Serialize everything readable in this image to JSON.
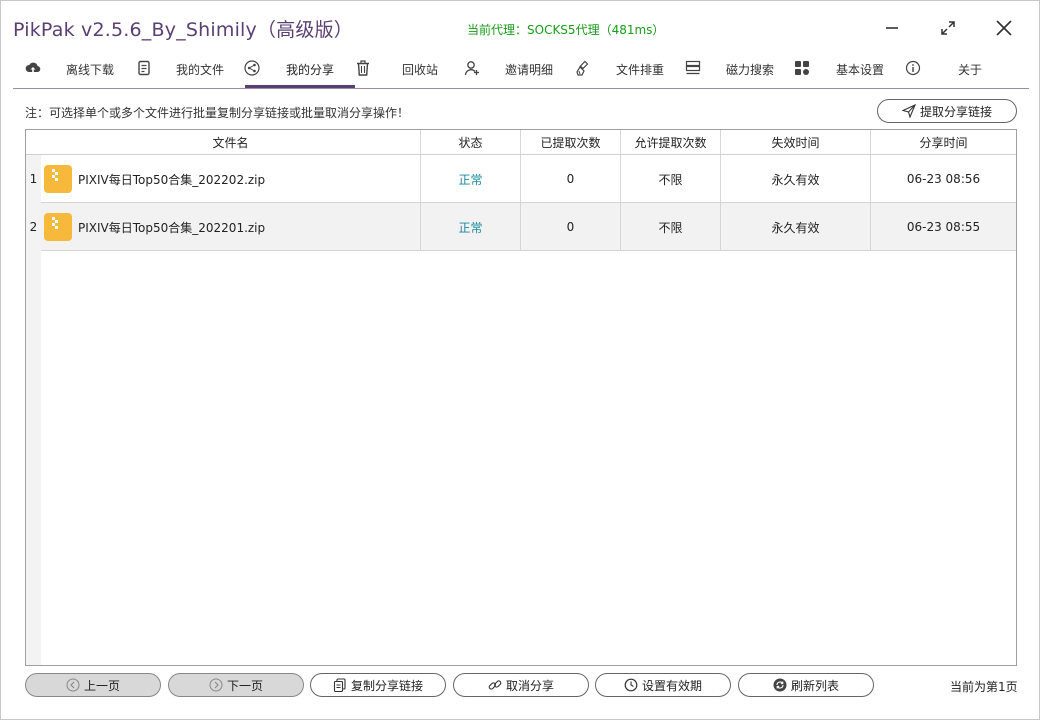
{
  "window": {
    "title": "PikPak v2.5.6_By_Shimily（高级版）",
    "proxy": "当前代理：SOCKS5代理（481ms）"
  },
  "tabs": [
    {
      "label": "离线下载",
      "icon": "cloud-upload-icon"
    },
    {
      "label": "我的文件",
      "icon": "document-icon"
    },
    {
      "label": "我的分享",
      "icon": "share-icon",
      "active": true
    },
    {
      "label": "回收站",
      "icon": "trash-icon"
    },
    {
      "label": "邀请明细",
      "icon": "add-user-icon"
    },
    {
      "label": "文件排重",
      "icon": "brush-icon"
    },
    {
      "label": "磁力搜索",
      "icon": "storage-icon"
    },
    {
      "label": "基本设置",
      "icon": "grid-settings-icon"
    },
    {
      "label": "关于",
      "icon": "info-icon"
    }
  ],
  "note": "注：可选择单个或多个文件进行批量复制分享链接或批量取消分享操作！",
  "extract_button": "提取分享链接",
  "table": {
    "columns": [
      "文件名",
      "状态",
      "已提取次数",
      "允许提取次数",
      "失效时间",
      "分享时间"
    ],
    "rows": [
      {
        "num": "1",
        "name": "PIXIV每日Top50合集_202202.zip",
        "status": "正常",
        "extracted": "0",
        "allowed": "不限",
        "expire": "永久有效",
        "time": "06-23 08:56"
      },
      {
        "num": "2",
        "name": "PIXIV每日Top50合集_202201.zip",
        "status": "正常",
        "extracted": "0",
        "allowed": "不限",
        "expire": "永久有效",
        "time": "06-23 08:55"
      }
    ]
  },
  "footer": {
    "prev": "上一页",
    "next": "下一页",
    "copy": "复制分享链接",
    "cancel": "取消分享",
    "validity": "设置有效期",
    "refresh": "刷新列表",
    "page_info": "当前为第1页"
  },
  "colors": {
    "brand": "#5a3f73",
    "proxy_text": "#1a9a1a",
    "status_ok": "#1a8a9a",
    "zip_icon": "#f6b93b"
  }
}
